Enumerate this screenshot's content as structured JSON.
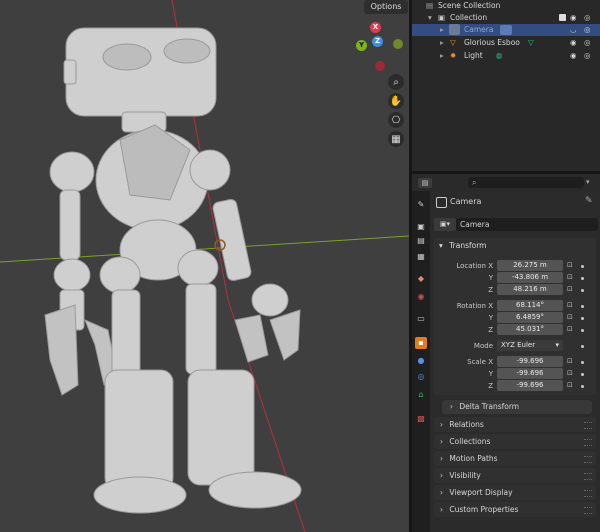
{
  "viewport": {
    "options_label": "Options",
    "axis_labels": {
      "x": "X",
      "y": "Y",
      "z": "Z"
    },
    "tool_icons": [
      "zoom-icon",
      "hand-icon",
      "camera-icon",
      "grid-icon"
    ]
  },
  "outliner": {
    "scene_collection": "Scene Collection",
    "collection": "Collection",
    "items": [
      {
        "name": "Camera",
        "selected": true
      },
      {
        "name": "Glorious Esboo",
        "selected": false
      },
      {
        "name": "Light",
        "selected": false
      }
    ]
  },
  "properties": {
    "object_name": "Camera",
    "data_name": "Camera",
    "transform_title": "Transform",
    "location": {
      "label": "Location X",
      "x": "26.275 m",
      "y": "-43.806 m",
      "z": "48.216 m"
    },
    "rotation": {
      "label": "Rotation X",
      "x": "68.114°",
      "y": "6.4859°",
      "z": "45.031°"
    },
    "mode_label": "Mode",
    "mode_value": "XYZ Euler",
    "scale": {
      "label": "Scale X",
      "x": "-99.696",
      "y": "-99.696",
      "z": "-99.696"
    },
    "axis_y": "Y",
    "axis_z": "Z",
    "delta_transform": "Delta Transform",
    "sections": [
      "Relations",
      "Collections",
      "Motion Paths",
      "Visibility",
      "Viewport Display",
      "Custom Properties"
    ]
  },
  "colors": {
    "x_axis": "#e3394f",
    "y_axis": "#7cb41c",
    "z_axis": "#3f8ee6",
    "selection": "#334d80",
    "orange_tab": "#e07c1b"
  }
}
